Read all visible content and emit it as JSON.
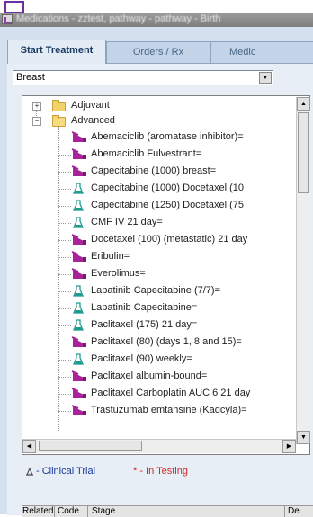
{
  "window": {
    "title": "Medications - zztest, pathway - pathway - Birth"
  },
  "tabs": [
    {
      "label": "Start Treatment",
      "active": true
    },
    {
      "label": "Orders / Rx",
      "active": false
    },
    {
      "label": "Medic",
      "active": false
    }
  ],
  "disease_select": {
    "value": "Breast"
  },
  "tree": {
    "folders": [
      {
        "label": "Adjuvant",
        "expanded": false,
        "expander": "+"
      },
      {
        "label": "Advanced",
        "expanded": true,
        "expander": "−"
      }
    ],
    "items": [
      {
        "label": "Abemaciclib (aromatase inhibitor)=",
        "icon": "syringe-icon"
      },
      {
        "label": "Abemaciclib Fulvestrant=",
        "icon": "syringe-icon"
      },
      {
        "label": "Capecitabine (1000) breast=",
        "icon": "syringe-icon"
      },
      {
        "label": "Capecitabine (1000) Docetaxel (10",
        "icon": "flask-icon"
      },
      {
        "label": "Capecitabine (1250) Docetaxel (75",
        "icon": "flask-icon"
      },
      {
        "label": "CMF IV 21 day=",
        "icon": "flask-icon"
      },
      {
        "label": "Docetaxel (100) (metastatic) 21 day",
        "icon": "syringe-icon"
      },
      {
        "label": "Eribulin=",
        "icon": "syringe-icon"
      },
      {
        "label": "Everolimus=",
        "icon": "syringe-icon"
      },
      {
        "label": "Lapatinib Capecitabine (7/7)=",
        "icon": "flask-icon"
      },
      {
        "label": "Lapatinib Capecitabine=",
        "icon": "flask-icon"
      },
      {
        "label": "Paclitaxel (175) 21 day=",
        "icon": "flask-icon"
      },
      {
        "label": "Paclitaxel (80) (days 1, 8 and 15)=",
        "icon": "syringe-icon"
      },
      {
        "label": "Paclitaxel (90) weekly=",
        "icon": "flask-icon"
      },
      {
        "label": "Paclitaxel albumin-bound=",
        "icon": "syringe-icon"
      },
      {
        "label": "Paclitaxel Carboplatin AUC 6 21 day",
        "icon": "syringe-icon"
      },
      {
        "label": "Trastuzumab emtansine (Kadcyla)=",
        "icon": "syringe-icon"
      }
    ]
  },
  "legend": {
    "clinical_trial": "- Clinical Trial",
    "in_testing": "* - In Testing"
  },
  "bottom_table": {
    "columns": [
      "Related",
      "Code",
      "Stage",
      "De"
    ]
  },
  "colors": {
    "trial_text": "#1a3a9a",
    "testing_text": "#d02828",
    "syringe": "#a8239a",
    "flask": "#1f9a8e"
  }
}
